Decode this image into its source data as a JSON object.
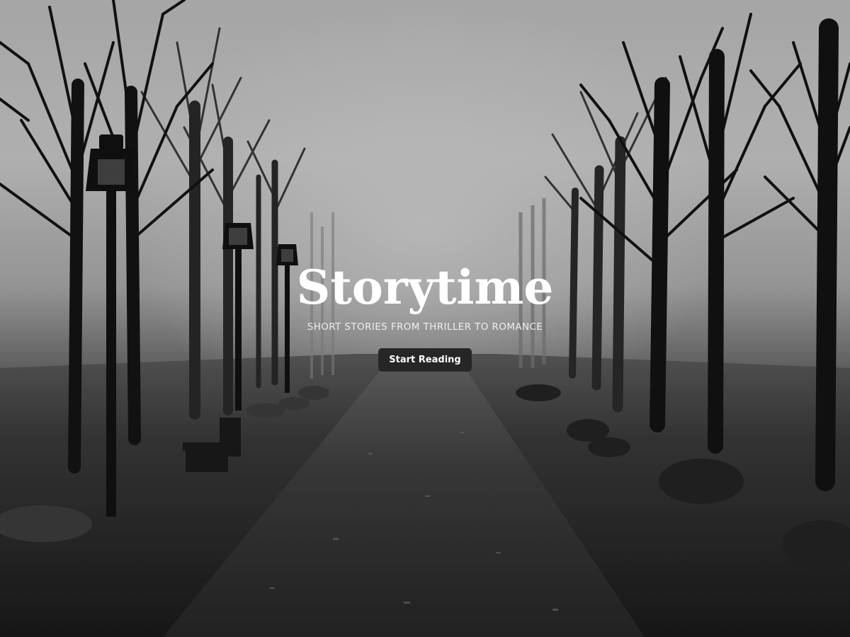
{
  "hero": {
    "title": "Storytime",
    "subtitle": "SHORT STORIES FROM THRILLER TO ROMANCE",
    "cta_label": "Start Reading",
    "background_description": "foggy-park-path-with-bare-trees-and-lamp-posts"
  },
  "colors": {
    "fog": "#c9c9c9",
    "ground": "#2b2b2b",
    "path": "#3a3a3a",
    "tree": "#151515",
    "button_bg": "#262626",
    "text": "#ffffff"
  }
}
